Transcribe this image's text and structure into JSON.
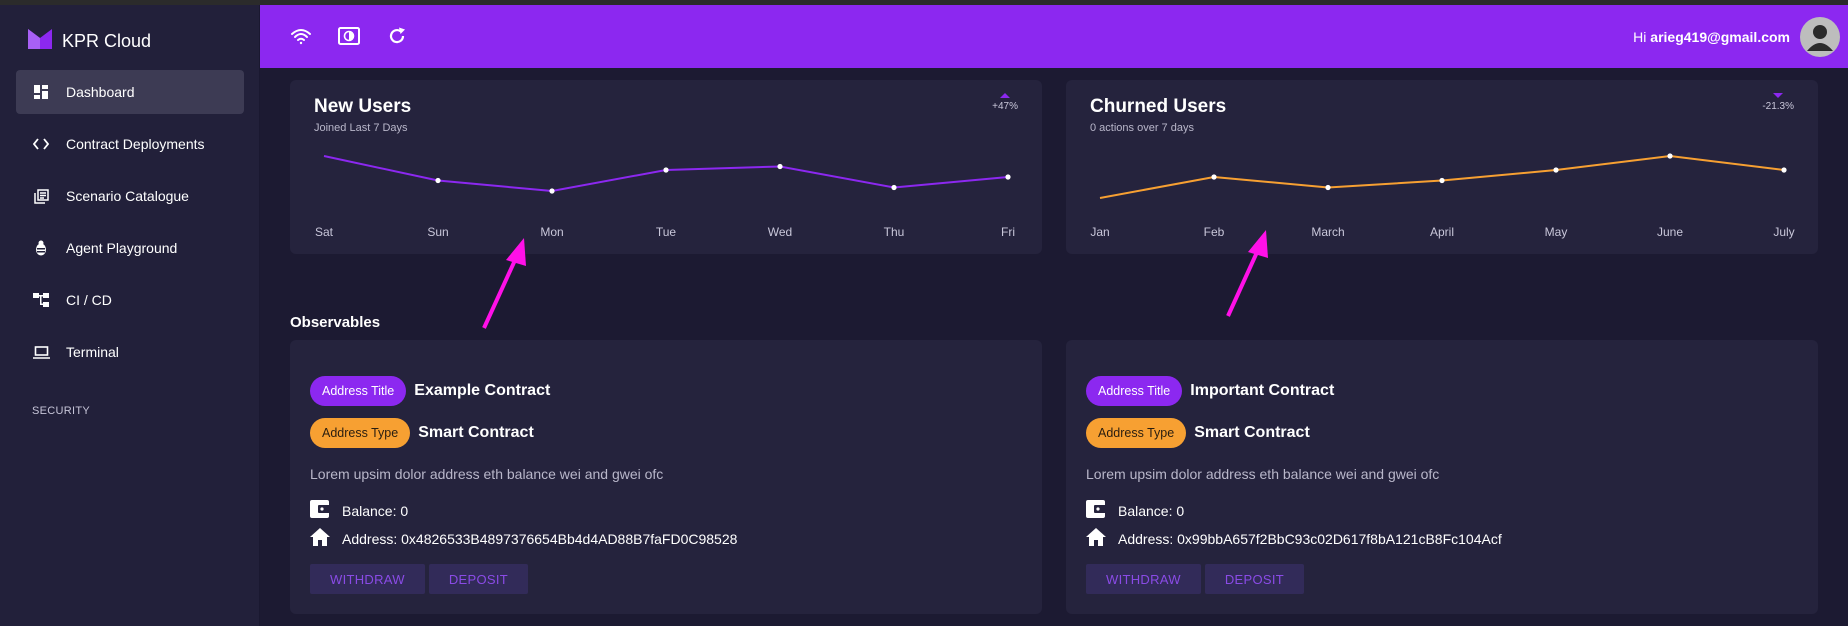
{
  "brand": {
    "name": "KPR Cloud"
  },
  "sidebar": {
    "items": [
      {
        "label": "Dashboard",
        "icon": "dashboard-icon",
        "active": true
      },
      {
        "label": "Contract Deployments",
        "icon": "code-icon"
      },
      {
        "label": "Scenario Catalogue",
        "icon": "library-icon"
      },
      {
        "label": "Agent Playground",
        "icon": "bug-icon"
      },
      {
        "label": "CI / CD",
        "icon": "account-tree-icon"
      },
      {
        "label": "Terminal",
        "icon": "laptop-icon"
      }
    ],
    "section_label": "SECURITY"
  },
  "header": {
    "icons": [
      "network-wifi-icon",
      "brightness-icon",
      "refresh-icon"
    ],
    "greeting_prefix": "Hi",
    "user_email": "arieg419@gmail.com"
  },
  "colors": {
    "accent": "#8c28f0",
    "orange": "#f7a032",
    "background": "#1c1a32",
    "card": "#25233d"
  },
  "new_users": {
    "title": "New Users",
    "subtitle": "Joined Last 7 Days",
    "delta": "+47%"
  },
  "churned_users": {
    "title": "Churned Users",
    "subtitle": "0 actions over 7 days",
    "delta": "-21.3%"
  },
  "chart_data": [
    {
      "type": "line",
      "categories": [
        "Sat",
        "Sun",
        "Mon",
        "Tue",
        "Wed",
        "Thu",
        "Fri"
      ],
      "values": [
        16,
        9,
        6,
        12,
        13,
        7,
        10
      ],
      "color": "#8c28f0",
      "ylim": [
        0,
        20
      ]
    },
    {
      "type": "line",
      "categories": [
        "Jan",
        "Feb",
        "March",
        "April",
        "May",
        "June",
        "July"
      ],
      "values": [
        4,
        10,
        7,
        9,
        12,
        16,
        12
      ],
      "color": "#f7a032",
      "ylim": [
        0,
        20
      ]
    }
  ],
  "observables": {
    "title": "Observables",
    "cards": [
      {
        "address_title_label": "Address Title",
        "address_title_value": "Example Contract",
        "address_type_label": "Address Type",
        "address_type_value": "Smart Contract",
        "description": "Lorem upsim dolor address eth balance wei and gwei ofc",
        "balance": "Balance: 0",
        "address": "Address: 0x4826533B4897376654Bb4d4AD88B7faFD0C98528",
        "withdraw_label": "WITHDRAW",
        "deposit_label": "DEPOSIT"
      },
      {
        "address_title_label": "Address Title",
        "address_title_value": "Important Contract",
        "address_type_label": "Address Type",
        "address_type_value": "Smart Contract",
        "description": "Lorem upsim dolor address eth balance wei and gwei ofc",
        "balance": "Balance: 0",
        "address": "Address: 0x99bbA657f2BbC93c02D617f8bA121cB8Fc104Acf",
        "withdraw_label": "WITHDRAW",
        "deposit_label": "DEPOSIT"
      }
    ]
  }
}
